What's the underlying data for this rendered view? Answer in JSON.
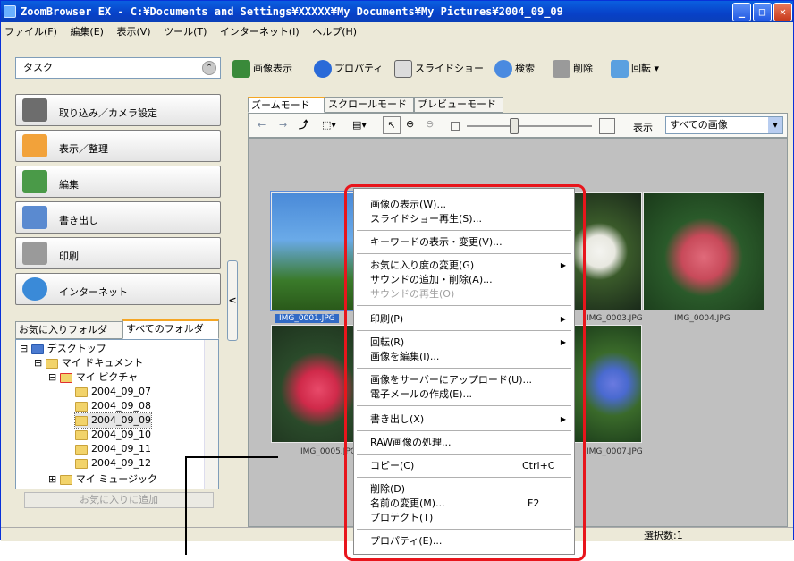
{
  "window": {
    "title": "ZoomBrowser EX - C:¥Documents and Settings¥XXXXX¥My Documents¥My Pictures¥2004_09_09",
    "buttons": {
      "minimize": "_",
      "maximize": "□",
      "close": "✕"
    }
  },
  "menubar": [
    "ファイル(F)",
    "編集(E)",
    "表示(V)",
    "ツール(T)",
    "インターネット(I)",
    "ヘルプ(H)"
  ],
  "sidebar": {
    "task_label": "タスク",
    "tasks": [
      "取り込み／カメラ設定",
      "表示／整理",
      "編集",
      "書き出し",
      "印刷",
      "インターネット"
    ],
    "folder_tabs": [
      "お気に入りフォルダ",
      "すべてのフォルダ"
    ],
    "tree": [
      "デスクトップ",
      "マイ ドキュメント",
      "マイ ピクチャ",
      "2004_09_07",
      "2004_09_08",
      "2004_09_09",
      "2004_09_10",
      "2004_09_11",
      "2004_09_12",
      "マイ ミュージック"
    ],
    "add_favorite": "お気に入りに追加"
  },
  "toolbar": {
    "view": "画像表示",
    "properties": "プロパティ",
    "slideshow": "スライドショー",
    "search": "検索",
    "delete": "削除",
    "rotate": "回転"
  },
  "view_tabs": [
    "ズームモード",
    "スクロールモード",
    "プレビューモード"
  ],
  "subbar": {
    "display_label": "表示",
    "filter": "すべての画像"
  },
  "thumbnails": {
    "captions": [
      "IMG_0001.JPG",
      "IMG_0004.JPG",
      "IMG_0005.JPG",
      "IMG_0003.JPG",
      "IMG_0007.JPG"
    ]
  },
  "context_menu": {
    "items": [
      "画像の表示(W)...",
      "スライドショー再生(S)...",
      "キーワードの表示・変更(V)...",
      "お気に入り度の変更(G)",
      "サウンドの追加・削除(A)...",
      "サウンドの再生(O)",
      "印刷(P)",
      "回転(R)",
      "画像を編集(I)...",
      "画像をサーバーにアップロード(U)...",
      "電子メールの作成(E)...",
      "書き出し(X)",
      "RAW画像の処理...",
      "コピー(C)",
      "削除(D)",
      "名前の変更(M)...",
      "プロテクト(T)",
      "プロパティ(E)..."
    ],
    "shortcuts": {
      "copy": "Ctrl+C",
      "rename": "F2"
    }
  },
  "status": {
    "selection": "選択数:1"
  },
  "colors": {
    "highlight": "#e8151c",
    "title_blue": "#0a5fe0"
  }
}
